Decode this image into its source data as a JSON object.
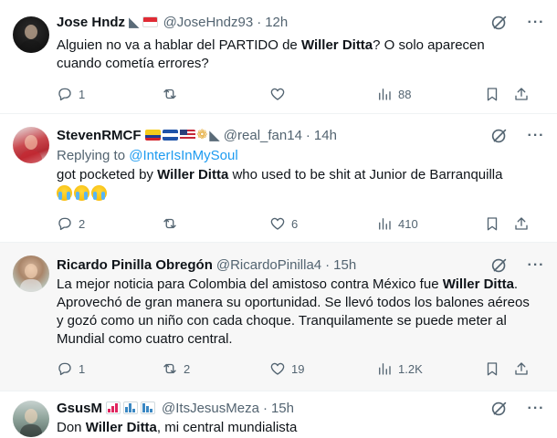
{
  "tweets": [
    {
      "name": "Jose Hndz",
      "emojis": [
        "shark",
        "flag-indonesia"
      ],
      "handle": "@JoseHndz93",
      "time": "12h",
      "reply_to": "",
      "text_parts": [
        "Alguien no va a hablar del PARTIDO de ",
        "Willer Ditta",
        "? O solo aparecen cuando cometía errores?"
      ],
      "counts": {
        "reply": "1",
        "retweet": "",
        "like": "",
        "views": "88"
      }
    },
    {
      "name": "StevenRMCF",
      "emojis": [
        "flag-colombia",
        "flag-el-salvador",
        "flag-usa",
        "folded-hands",
        "shark"
      ],
      "handle": "@real_fan14",
      "time": "14h",
      "reply_prefix": "Replying to ",
      "reply_to": "@InterIsInMySoul",
      "text_parts": [
        "got pocketed by ",
        "Willer Ditta",
        " who used to be shit at Junior de Barranquilla"
      ],
      "trailing_emojis": [
        "loudly-crying-face",
        "loudly-crying-face",
        "loudly-crying-face"
      ],
      "counts": {
        "reply": "2",
        "retweet": "",
        "like": "6",
        "views": "410"
      }
    },
    {
      "name": "Ricardo Pinilla Obregón",
      "emojis": [],
      "handle": "@RicardoPinilla4",
      "time": "15h",
      "reply_to": "",
      "text_parts": [
        "La mejor noticia para Colombia del amistoso contra México fue ",
        "Willer Ditta",
        ". Aprovechó de gran manera su oportunidad. Se llevó todos los balones aéreos y gozó como un niño con cada choque. Tranquilamente se puede meter al Mundial como cuatro central."
      ],
      "counts": {
        "reply": "1",
        "retweet": "2",
        "like": "19",
        "views": "1.2K"
      }
    },
    {
      "name": "GsusM",
      "emojis": [
        "chart-increasing",
        "bar-chart",
        "chart-decreasing"
      ],
      "handle": "@ItsJesusMeza",
      "time": "15h",
      "reply_to": "",
      "text_parts": [
        "Don ",
        "Willer Ditta",
        ", mi central mundialista"
      ],
      "counts": {
        "reply": "",
        "retweet": "",
        "like": "",
        "views": ""
      }
    }
  ],
  "separator": "·",
  "more_label": "···",
  "icons": [
    "reply-icon",
    "retweet-icon",
    "like-icon",
    "views-icon",
    "bookmark-icon",
    "share-icon",
    "grok-icon"
  ],
  "colors": {
    "link": "#1d9bf0",
    "secondary": "#536471",
    "text": "#0f1419",
    "shaded_bg": "#f7f7f7"
  }
}
